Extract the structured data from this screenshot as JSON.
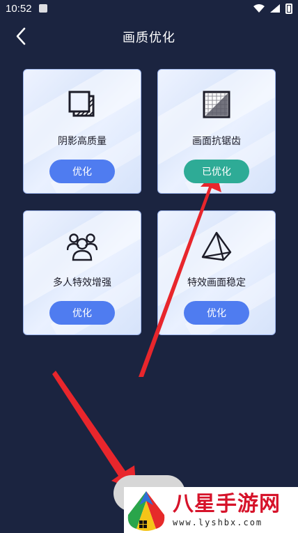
{
  "status_bar": {
    "time": "10:52"
  },
  "header": {
    "title": "画质优化",
    "back_icon": "chevron-left-icon"
  },
  "cards": [
    {
      "label": "阴影高质量",
      "button": "优化",
      "icon": "shadow-layers-icon",
      "optimized": false
    },
    {
      "label": "画面抗锯齿",
      "button": "已优化",
      "icon": "antialias-grid-icon",
      "optimized": true
    },
    {
      "label": "多人特效增强",
      "button": "优化",
      "icon": "multi-user-icon",
      "optimized": false
    },
    {
      "label": "特效画面稳定",
      "button": "优化",
      "icon": "pyramid-icon",
      "optimized": false
    }
  ],
  "colors": {
    "background": "#1b2440",
    "button": "#4f7cf0",
    "button_done": "#2eab96",
    "arrow": "#e8262c",
    "watermark_text": "#d6132a"
  },
  "watermark": {
    "title": "八星手游网",
    "url": "www.lyshbx.com"
  }
}
